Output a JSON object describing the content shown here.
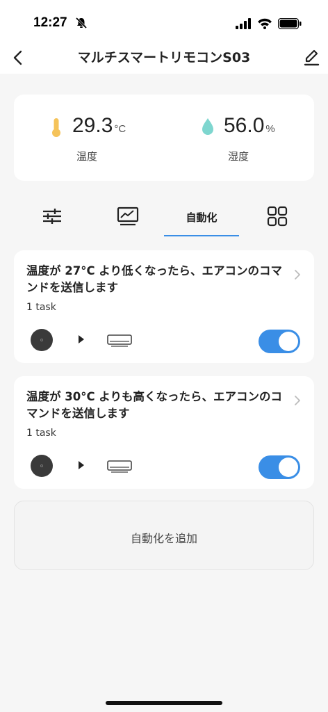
{
  "status": {
    "time": "12:27"
  },
  "nav": {
    "title": "マルチスマートリモコンS03"
  },
  "sensor": {
    "temperature": {
      "value": "29.3",
      "unit": "°C",
      "label": "温度"
    },
    "humidity": {
      "value": "56.0",
      "unit": "%",
      "label": "湿度"
    }
  },
  "tabs": {
    "active_label": "自動化",
    "icons": [
      "sliders-icon",
      "chart-icon",
      "automation",
      "grid-icon"
    ]
  },
  "automations": [
    {
      "title": "温度が 27°C より低くなったら、エアコンのコマンドを送信します",
      "tasks": "1 task",
      "enabled": true
    },
    {
      "title": "温度が 30°C よりも高くなったら、エアコンのコマンドを送信します",
      "tasks": "1 task",
      "enabled": true
    }
  ],
  "add_automation": {
    "label": "自動化を追加"
  },
  "colors": {
    "accent": "#3a8ee6",
    "thermometer": "#f5c35a",
    "droplet": "#7ed6cf"
  }
}
